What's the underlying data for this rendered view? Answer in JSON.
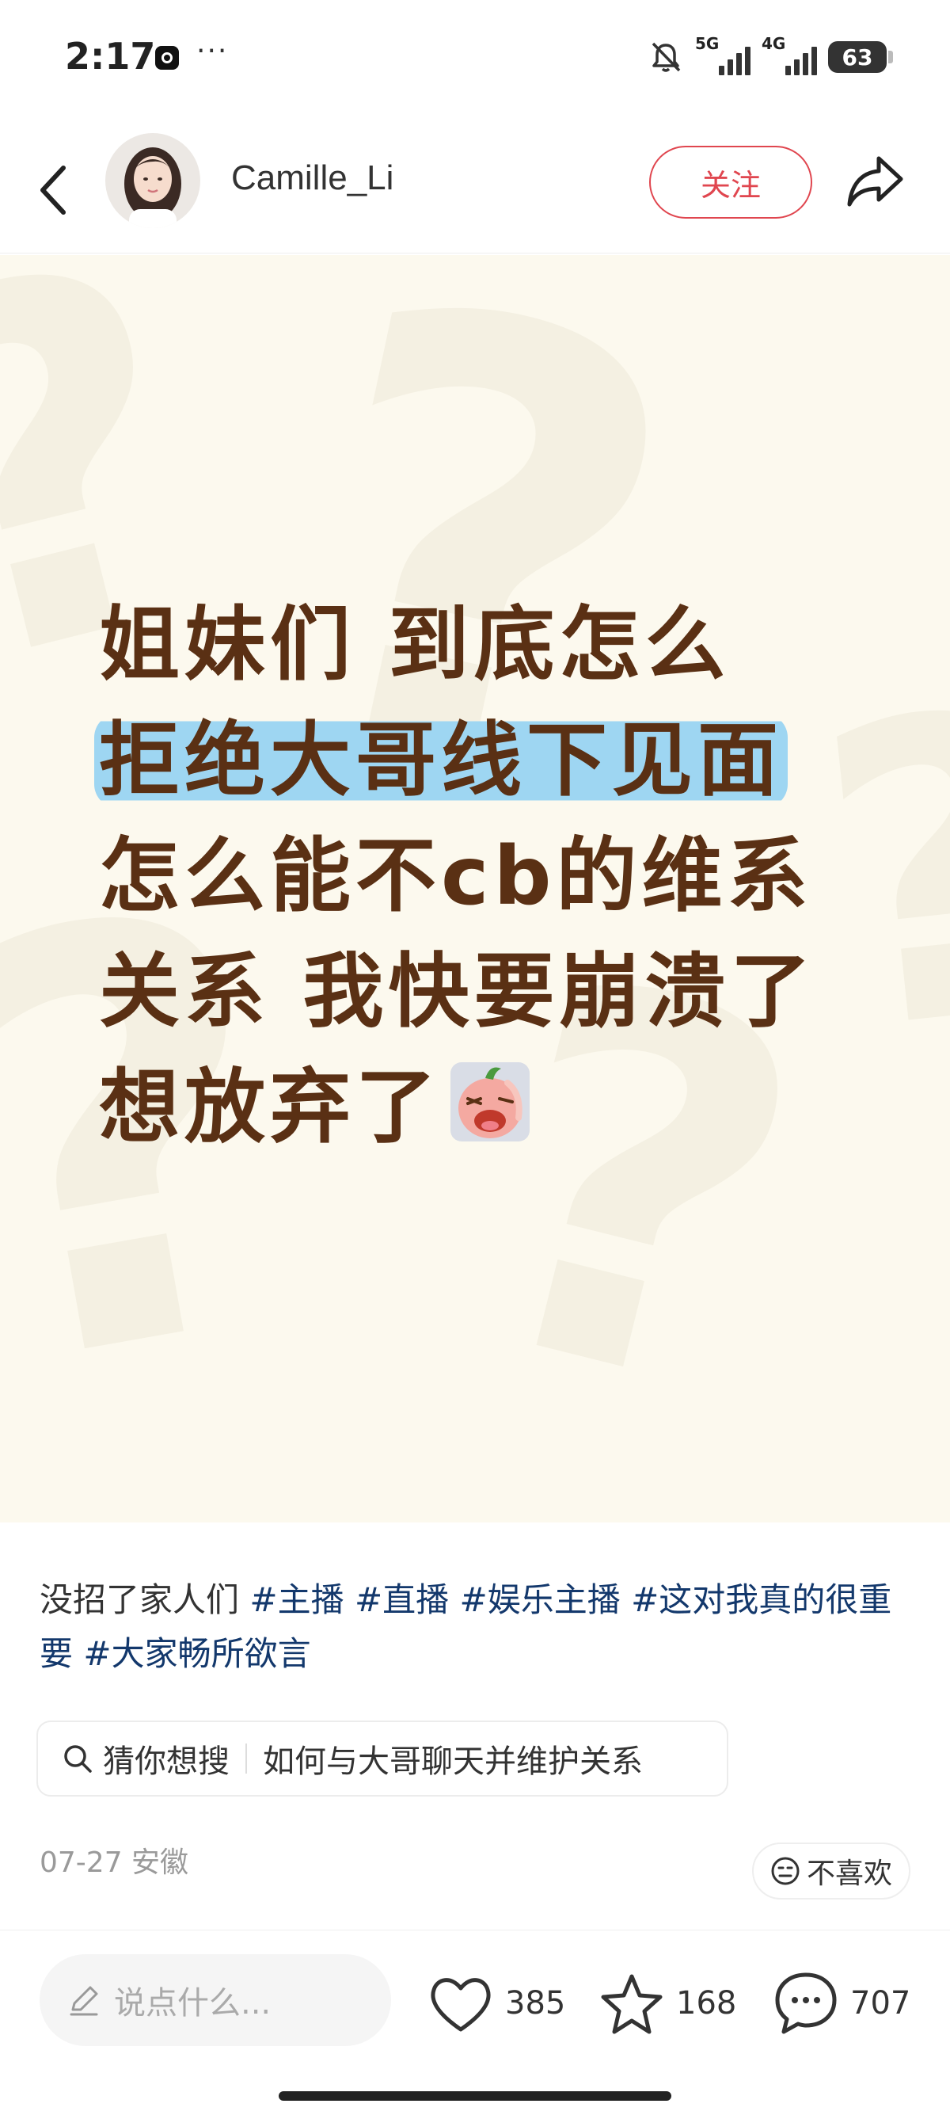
{
  "status_bar": {
    "time": "2:17",
    "dots": "···",
    "network_1": "5G",
    "network_2": "4G",
    "battery": "63"
  },
  "header": {
    "username": "Camille_Li",
    "follow_label": "关注"
  },
  "post": {
    "image_lines": [
      "姐妹们 到底怎么",
      "拒绝大哥线下见面",
      "怎么能不cb的维系",
      "关系 我快要崩溃了",
      "想放弃了"
    ],
    "caption_text": "没招了家人们",
    "tags": [
      "#主播",
      "#直播",
      "#娱乐主播",
      "#这对我真的很重要",
      "#大家畅所欲言"
    ],
    "search_label": "猜你想搜",
    "search_query": "如何与大哥聊天并维护关系",
    "date_location": "07-27 安徽",
    "dislike_label": "不喜欢"
  },
  "bottom_bar": {
    "comment_placeholder": "说点什么...",
    "likes": "385",
    "favorites": "168",
    "comments": "707"
  },
  "colors": {
    "accent": "#e0464f",
    "tag": "#13386c",
    "text_brown": "#5a3014",
    "highlight": "#9ed6f2",
    "card_bg": "#fcf9ee"
  }
}
